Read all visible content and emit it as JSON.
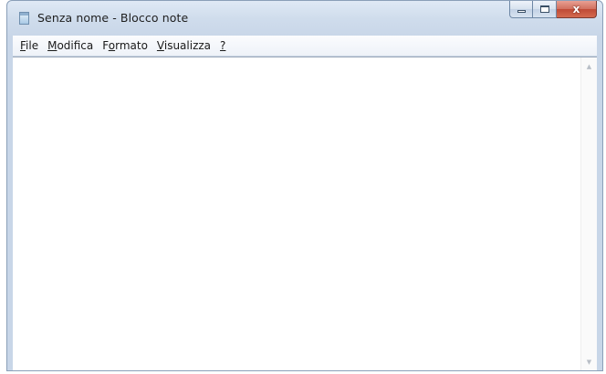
{
  "window": {
    "title": "Senza nome - Blocco note",
    "icon": "notepad-icon",
    "caption_buttons": {
      "minimize": "minimize-icon",
      "maximize": "maximize-icon",
      "close": "close-icon",
      "close_glyph": "x"
    }
  },
  "menu": {
    "items": [
      {
        "accel": "F",
        "rest": "ile"
      },
      {
        "accel": "M",
        "rest": "odifica"
      },
      {
        "lead": "F",
        "accel": "o",
        "rest": "rmato"
      },
      {
        "accel": "V",
        "rest": "isualizza"
      },
      {
        "accel": "?",
        "rest": ""
      }
    ]
  },
  "editor": {
    "content": ""
  },
  "scrollbar": {
    "up_icon": "scroll-up-arrow-icon",
    "down_icon": "scroll-down-arrow-icon",
    "up_glyph": "▲",
    "down_glyph": "▼"
  },
  "colors": {
    "frame": "#c8d6e8",
    "close_button": "#c8503b",
    "text": "#1a1a1a"
  }
}
